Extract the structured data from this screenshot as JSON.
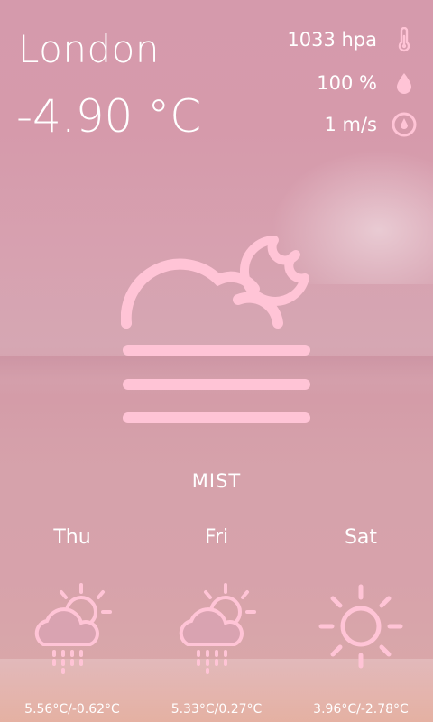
{
  "city": "London",
  "temperature": "-4.90 °C",
  "stats": {
    "pressure": {
      "value": "1033 hpa",
      "icon": "thermometer-icon"
    },
    "humidity": {
      "value": "100 %",
      "icon": "water-drop-icon"
    },
    "wind": {
      "value": "1 m/s",
      "icon": "wind-gauge-icon"
    }
  },
  "condition": "MIST",
  "main_icon": "mist-night-icon",
  "forecast": [
    {
      "day": "Thu",
      "range": "5.56°C/-0.62°C",
      "icon": "partly-sunny-rain-icon"
    },
    {
      "day": "Fri",
      "range": "5.33°C/0.27°C",
      "icon": "partly-sunny-rain-icon"
    },
    {
      "day": "Sat",
      "range": "3.96°C/-2.78°C",
      "icon": "sun-icon"
    }
  ],
  "colors": {
    "accent_pink": "#ffc4d6",
    "text": "#ffffff"
  }
}
